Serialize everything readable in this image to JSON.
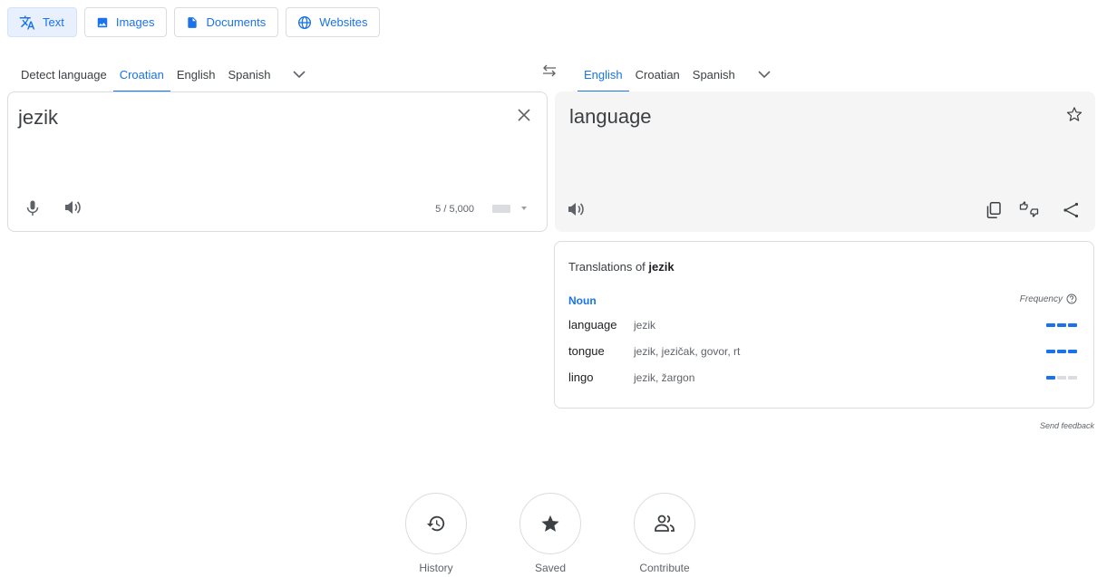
{
  "mode_tabs": [
    {
      "label": "Text",
      "icon": "translate-icon",
      "active": true
    },
    {
      "label": "Images",
      "icon": "image-icon",
      "active": false
    },
    {
      "label": "Documents",
      "icon": "document-icon",
      "active": false
    },
    {
      "label": "Websites",
      "icon": "globe-icon",
      "active": false
    }
  ],
  "source_languages": [
    "Detect language",
    "Croatian",
    "English",
    "Spanish"
  ],
  "source_active": "Croatian",
  "target_languages": [
    "English",
    "Croatian",
    "Spanish"
  ],
  "target_active": "English",
  "source": {
    "text": "jezik",
    "char_count": "5 / 5,000"
  },
  "target": {
    "text": "language"
  },
  "dictionary": {
    "title_prefix": "Translations of",
    "title_word": "jezik",
    "part_of_speech": "Noun",
    "frequency_label": "Frequency",
    "entries": [
      {
        "word": "language",
        "translations": "jezik",
        "frequency": 3
      },
      {
        "word": "tongue",
        "translations": "jezik, jezičak, govor, rt",
        "frequency": 3
      },
      {
        "word": "lingo",
        "translations": "jezik, žargon",
        "frequency": 1
      }
    ]
  },
  "send_feedback": "Send feedback",
  "bottom_actions": [
    {
      "label": "History",
      "icon": "history-icon"
    },
    {
      "label": "Saved",
      "icon": "star-icon"
    },
    {
      "label": "Contribute",
      "icon": "people-icon"
    }
  ],
  "colors": {
    "accent": "#1a73e8",
    "active_tab_bg": "#e8f0fe",
    "target_bg": "#f5f5f5"
  }
}
